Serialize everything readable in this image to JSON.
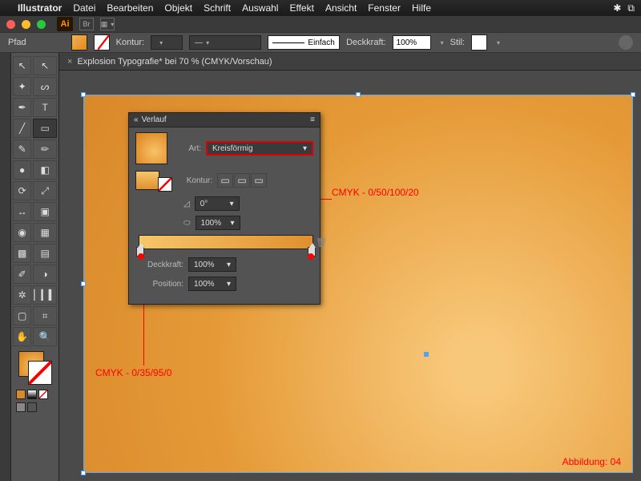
{
  "menubar": {
    "app": "Illustrator",
    "items": [
      "Datei",
      "Bearbeiten",
      "Objekt",
      "Schrift",
      "Auswahl",
      "Effekt",
      "Ansicht",
      "Fenster",
      "Hilfe"
    ]
  },
  "app_logo": "Ai",
  "bridge_icon": "Br",
  "control": {
    "path_label": "Pfad",
    "kontur_label": "Kontur:",
    "linestyle": "Einfach",
    "opacity_label": "Deckkraft:",
    "opacity_value": "100%",
    "style_label": "Stil:"
  },
  "doc_tab": "Explosion Typografie* bei 70 % (CMYK/Vorschau)",
  "gradient_panel": {
    "title": "Verlauf",
    "type_label": "Art:",
    "type_value": "Kreisförmig",
    "kontur_label": "Kontur:",
    "angle_value": "0°",
    "aspect_value": "100%",
    "opacity_label": "Deckkraft:",
    "opacity_value": "100%",
    "position_label": "Position:",
    "position_value": "100%"
  },
  "annotations": {
    "right_stop": "CMYK - 0/50/100/20",
    "left_stop": "CMYK - 0/35/95/0",
    "figure": "Abbildung: 04"
  },
  "colors": {
    "artboard_light": "#f8c87a",
    "artboard_dark": "#d9882a"
  }
}
